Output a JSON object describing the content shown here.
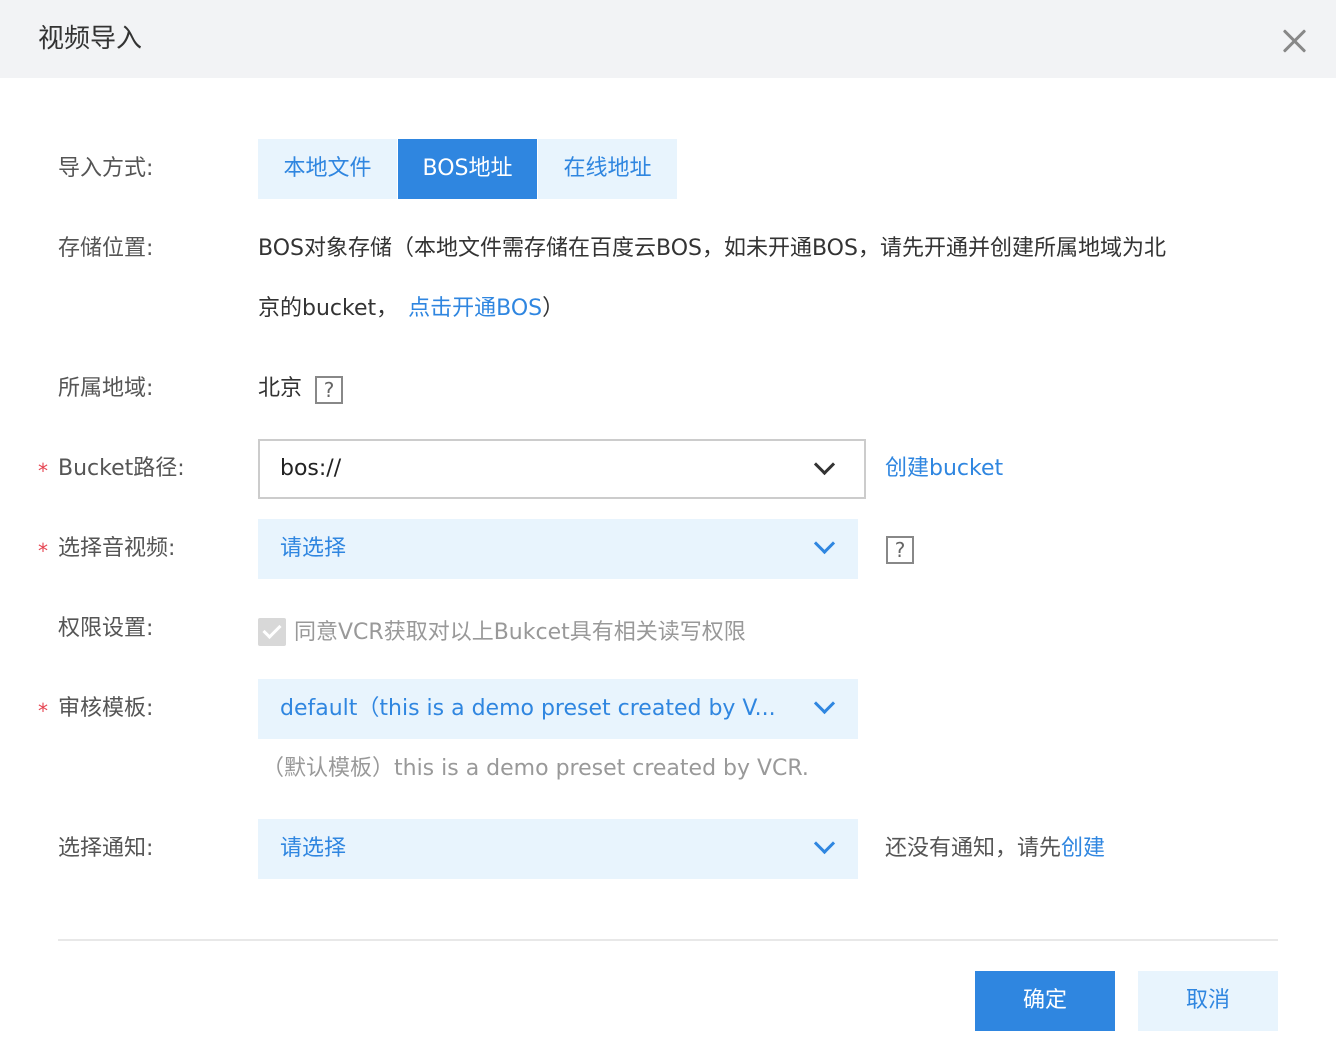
{
  "dialog": {
    "title": "视频导入"
  },
  "import_mode": {
    "label": "导入方式:",
    "options": [
      "本地文件",
      "BOS地址",
      "在线地址"
    ],
    "selected": "BOS地址"
  },
  "storage": {
    "label": "存储位置:",
    "line1": "BOS对象存储（本地文件需存储在百度云BOS，如未开通BOS，请先开通并创建所属地域为北",
    "line2_prefix": "京的bucket，",
    "link": "点击开通BOS",
    "line2_suffix": "）"
  },
  "region": {
    "label": "所属地域:",
    "value": "北京",
    "help_icon": "?"
  },
  "bucket": {
    "required": "*",
    "label": "Bucket路径:",
    "value": "bos://",
    "create_link": "创建bucket"
  },
  "media": {
    "required": "*",
    "label": "选择音视频:",
    "placeholder": "请选择",
    "help_icon": "?"
  },
  "permission": {
    "label": "权限设置:",
    "checkbox_text": "同意VCR获取对以上Bukcet具有相关读写权限",
    "checked": true
  },
  "template": {
    "required": "*",
    "label": "审核模板:",
    "value": "default（this is a demo preset created by V...",
    "hint": "（默认模板）this is a demo preset created by VCR."
  },
  "notify": {
    "label": "选择通知:",
    "placeholder": "请选择",
    "hint_prefix": "还没有通知，请先",
    "hint_link": "创建"
  },
  "footer": {
    "ok": "确定",
    "cancel": "取消"
  },
  "colors": {
    "accent": "#2f86e0",
    "accent_light": "#e8f4fd",
    "required": "#e64552"
  }
}
